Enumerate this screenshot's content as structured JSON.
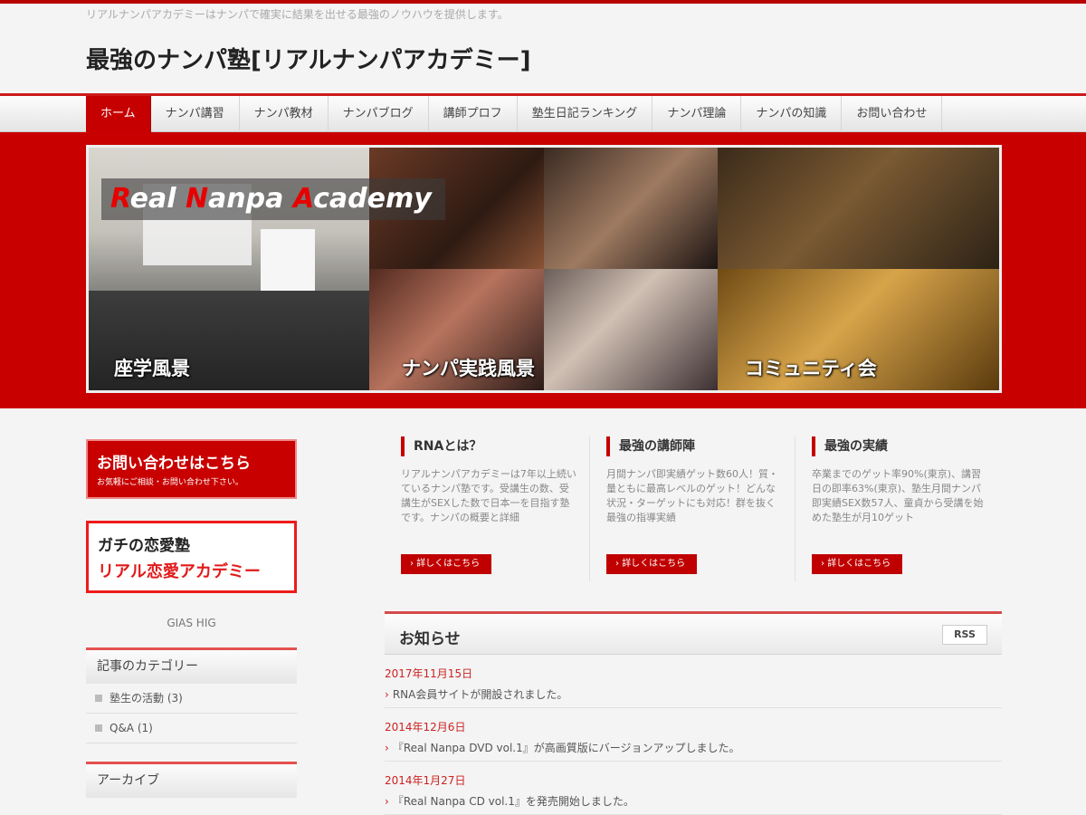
{
  "header": {
    "tagline": "リアルナンパアカデミーはナンパで確実に結果を出せる最強のノウハウを提供します。",
    "site_title": "最強のナンパ塾[リアルナンパアカデミー]"
  },
  "nav": [
    "ホーム",
    "ナンパ講習",
    "ナンパ教材",
    "ナンパブログ",
    "講師プロフ",
    "塾生日記ランキング",
    "ナンパ理論",
    "ナンパの知識",
    "お問い合わせ"
  ],
  "banner": {
    "logo_r": "R",
    "logo_eal": "eal ",
    "logo_n": "N",
    "logo_anpa": "anpa ",
    "logo_a": "A",
    "logo_cademy": "cademy",
    "caption_left": "座学風景",
    "caption_middle": "ナンパ実践風景",
    "caption_right": "コミュニティ会"
  },
  "sidebar": {
    "contact_title": "お問い合わせはこちら",
    "contact_sub": "お気軽にご相談・お問い合わせ下さい。",
    "love_line1": "ガチの恋愛塾",
    "love_line2": "リアル恋愛アカデミー",
    "image_alt": "GIAS HIG",
    "categories_heading": "記事のカテゴリー",
    "categories": [
      "塾生の活動 (3)",
      "Q&A (1)"
    ],
    "archive_heading": "アーカイブ"
  },
  "features": [
    {
      "title": "RNAとは？",
      "body": "リアルナンパアカデミーは7年以上続いているナンパ塾です。受講生の数、受講生がSEXした数で日本一を目指す塾です。ナンパの概要と詳細",
      "button": "詳しくはこちら"
    },
    {
      "title": "最強の講師陣",
      "body": "月間ナンパ即実績ゲット数60人！質・量ともに最高レベルのゲット！どんな状況・ターゲットにも対応！群を抜く最強の指導実績",
      "button": "詳しくはこちら"
    },
    {
      "title": "最強の実績",
      "body": "卒業までのゲット率90%(東京)、講習日の即率63%(東京)、塾生月間ナンパ即実績SEX数57人、童貞から受講を始めた塾生が月10ゲット",
      "button": "詳しくはこちら"
    }
  ],
  "news": {
    "heading": "お知らせ",
    "rss": "RSS",
    "items": [
      {
        "date": "2017年11月15日",
        "text": "RNA会員サイトが開設されました。"
      },
      {
        "date": "2014年12月6日",
        "text": "『Real Nanpa DVD vol.1』が高画質版にバージョンアップしました。"
      },
      {
        "date": "2014年1月27日",
        "text": "『Real Nanpa CD vol.1』を発売開始しました。"
      }
    ]
  },
  "colors": {
    "accent": "#c80000",
    "background": "#f4f4f4"
  },
  "icons": {
    "news_bullet": "chevron-right-icon",
    "category_bullet": "square-icon"
  }
}
